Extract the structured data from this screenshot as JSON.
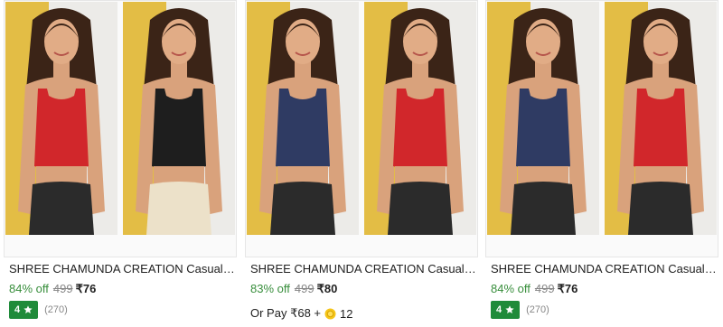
{
  "products": [
    {
      "title": "SHREE CHAMUNDA CREATION Casual Solid Women Black Top",
      "discount": "84% off",
      "mrp": "499",
      "price": "₹76",
      "rating": "4",
      "rating_count": "(270)",
      "images": [
        {
          "top_color": "#d1272b",
          "bottom_color": "#2b2b2b",
          "bg_color": "#e3bd45"
        },
        {
          "top_color": "#1e1e1e",
          "bottom_color": "#ece1c9",
          "bg_color": "#e3bd45"
        }
      ]
    },
    {
      "title": "SHREE CHAMUNDA CREATION Casual Solid Women Blue Top",
      "discount": "83% off",
      "mrp": "499",
      "price": "₹80",
      "pay_label": "Or Pay ₹68 +",
      "coins": "12",
      "images": [
        {
          "top_color": "#2f3b63",
          "bottom_color": "#2b2b2b",
          "bg_color": "#e3bd45"
        },
        {
          "top_color": "#d1272b",
          "bottom_color": "#2b2b2b",
          "bg_color": "#e3bd45"
        }
      ]
    },
    {
      "title": "SHREE CHAMUNDA CREATION Casual Solid Women Red Top",
      "discount": "84% off",
      "mrp": "499",
      "price": "₹76",
      "rating": "4",
      "rating_count": "(270)",
      "images": [
        {
          "top_color": "#2f3b63",
          "bottom_color": "#2b2b2b",
          "bg_color": "#e3bd45"
        },
        {
          "top_color": "#d1272b",
          "bottom_color": "#2b2b2b",
          "bg_color": "#e3bd45"
        }
      ]
    }
  ],
  "colors": {
    "discount_green": "#388e3c",
    "rating_badge": "#1f8b3a",
    "muted_text": "#878787",
    "coin_gold": "#f5c518"
  },
  "icons": {
    "rating": "star-icon",
    "coin": "supercoin-icon"
  }
}
